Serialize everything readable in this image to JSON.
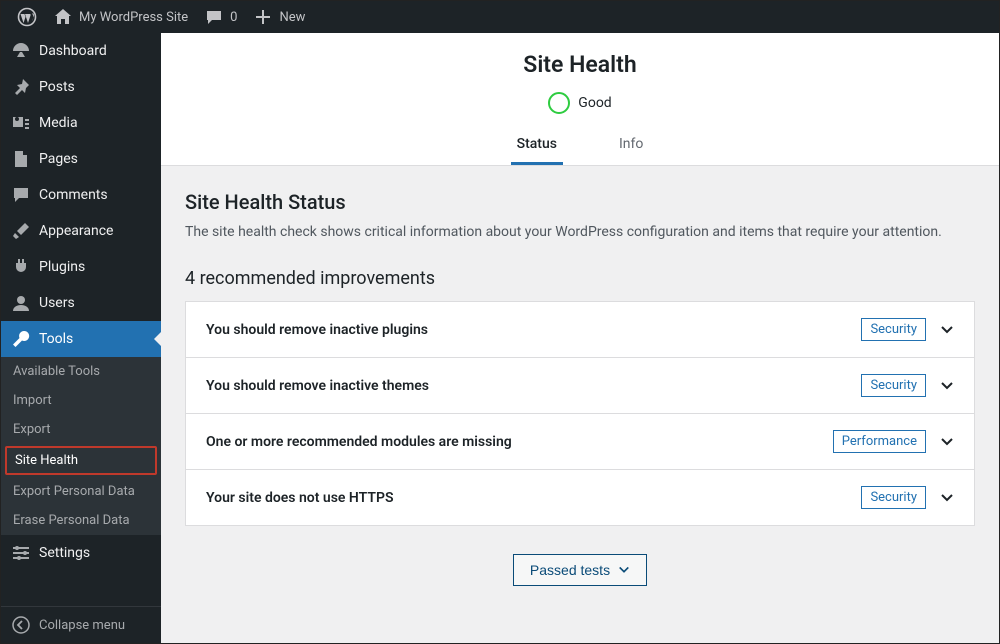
{
  "adminbar": {
    "site_name": "My WordPress Site",
    "comments": "0",
    "new": "New"
  },
  "sidebar": {
    "dashboard": "Dashboard",
    "posts": "Posts",
    "media": "Media",
    "pages": "Pages",
    "comments": "Comments",
    "appearance": "Appearance",
    "plugins": "Plugins",
    "users": "Users",
    "tools": "Tools",
    "settings": "Settings",
    "collapse": "Collapse menu",
    "submenu": {
      "available": "Available Tools",
      "import": "Import",
      "export": "Export",
      "site_health": "Site Health",
      "export_pd": "Export Personal Data",
      "erase_pd": "Erase Personal Data"
    }
  },
  "page": {
    "title": "Site Health",
    "status_label": "Good",
    "tabs": {
      "status": "Status",
      "info": "Info"
    },
    "section_heading": "Site Health Status",
    "section_desc": "The site health check shows critical information about your WordPress configuration and items that require your attention.",
    "improvements_heading": "4 recommended improvements",
    "issues": [
      {
        "title": "You should remove inactive plugins",
        "category": "Security"
      },
      {
        "title": "You should remove inactive themes",
        "category": "Security"
      },
      {
        "title": "One or more recommended modules are missing",
        "category": "Performance"
      },
      {
        "title": "Your site does not use HTTPS",
        "category": "Security"
      }
    ],
    "passed_label": "Passed tests"
  }
}
